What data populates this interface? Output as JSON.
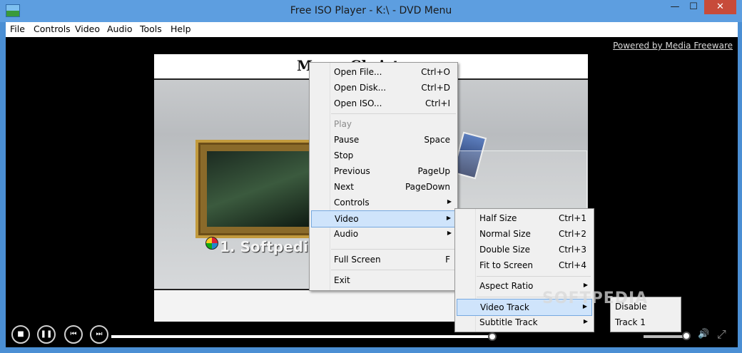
{
  "window": {
    "title": "Free ISO Player - K:\\ - DVD Menu",
    "min": "—",
    "max": "☐",
    "close": "✕"
  },
  "menubar": [
    "File",
    "Controls",
    "Video",
    "Audio",
    "Tools",
    "Help"
  ],
  "video": {
    "powered_by": "Powered by Media Freeware",
    "dvd_title": "Merry Christmas",
    "dvd_item": "1. Softpedi"
  },
  "context_menu": [
    {
      "label": "Open File...",
      "shortcut": "Ctrl+O"
    },
    {
      "label": "Open Disk...",
      "shortcut": "Ctrl+D"
    },
    {
      "label": "Open ISO...",
      "shortcut": "Ctrl+I"
    },
    {
      "label": "Play",
      "shortcut": "",
      "disabled": true
    },
    {
      "label": "Pause",
      "shortcut": "Space"
    },
    {
      "label": "Stop",
      "shortcut": ""
    },
    {
      "label": "Previous",
      "shortcut": "PageUp"
    },
    {
      "label": "Next",
      "shortcut": "PageDown"
    },
    {
      "label": "Controls",
      "shortcut": ""
    },
    {
      "label": "Video",
      "shortcut": ""
    },
    {
      "label": "Audio",
      "shortcut": ""
    },
    {
      "label": "Full Screen",
      "shortcut": "F"
    },
    {
      "label": "Exit",
      "shortcut": ""
    }
  ],
  "video_menu": [
    {
      "label": "Half Size",
      "shortcut": "Ctrl+1"
    },
    {
      "label": "Normal Size",
      "shortcut": "Ctrl+2"
    },
    {
      "label": "Double Size",
      "shortcut": "Ctrl+3"
    },
    {
      "label": "Fit to Screen",
      "shortcut": "Ctrl+4"
    },
    {
      "label": "Aspect Ratio",
      "shortcut": ""
    },
    {
      "label": "Video Track",
      "shortcut": ""
    },
    {
      "label": "Subtitle Track",
      "shortcut": ""
    }
  ],
  "video_track_menu": [
    {
      "label": "Disable"
    },
    {
      "label": "Track 1"
    }
  ],
  "controls": {
    "stop_icon": "■",
    "pause_icon": "❚❚",
    "prev_icon": "⏮",
    "next_icon": "⏭",
    "seek_percent": 64,
    "volume_percent": 95
  },
  "watermark": "SOFTPEDIA"
}
